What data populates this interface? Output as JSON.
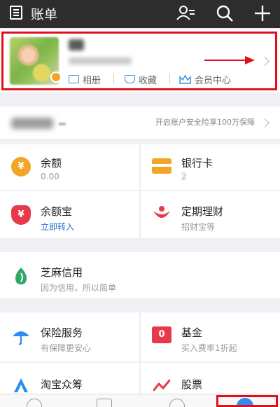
{
  "header": {
    "title": "账单",
    "icons": [
      "document-icon",
      "contacts-icon",
      "search-icon",
      "plus-icon"
    ]
  },
  "profile": {
    "links": [
      {
        "label": "相册",
        "icon": "album-icon"
      },
      {
        "label": "收藏",
        "icon": "favorites-icon"
      },
      {
        "label": "会员中心",
        "icon": "crown-icon"
      }
    ]
  },
  "security": {
    "text": "开启账户安全险享100万保障"
  },
  "grid": [
    {
      "label": "余额",
      "sub": "0.00",
      "icon": "balance-icon",
      "color": "#f3a52a",
      "glyph": "¥"
    },
    {
      "label": "银行卡",
      "sub": "2",
      "icon": "bank-card-icon",
      "color": "#f3a52a",
      "glyph": ""
    },
    {
      "label": "余额宝",
      "sub": "立即转入",
      "icon": "yuebao-icon",
      "color": "#e8394a",
      "glyph": "¥"
    },
    {
      "label": "定期理财",
      "sub": "招财宝等",
      "icon": "fixed-finance-icon",
      "color": "#e8394a",
      "glyph": ""
    },
    {
      "label": "芝麻信用",
      "sub": "因为信用，所以简单",
      "icon": "sesame-credit-icon",
      "color": "#2ea866",
      "glyph": ""
    },
    {
      "label": "保险服务",
      "sub": "有保障更安心",
      "icon": "insurance-icon",
      "color": "#2b8df0",
      "glyph": ""
    },
    {
      "label": "基金",
      "sub": "买入费率1折起",
      "icon": "fund-icon",
      "color": "#e8394a",
      "glyph": "0"
    },
    {
      "label": "淘宝众筹",
      "sub": "",
      "icon": "crowdfunding-icon",
      "color": "#2b8df0",
      "glyph": ""
    },
    {
      "label": "股票",
      "sub": "",
      "icon": "stock-icon",
      "color": "#e8394a",
      "glyph": ""
    }
  ],
  "colors": {
    "header_bg": "#2d2d2d",
    "highlight_red": "#e0101a",
    "link_blue": "#2b6bd6"
  }
}
